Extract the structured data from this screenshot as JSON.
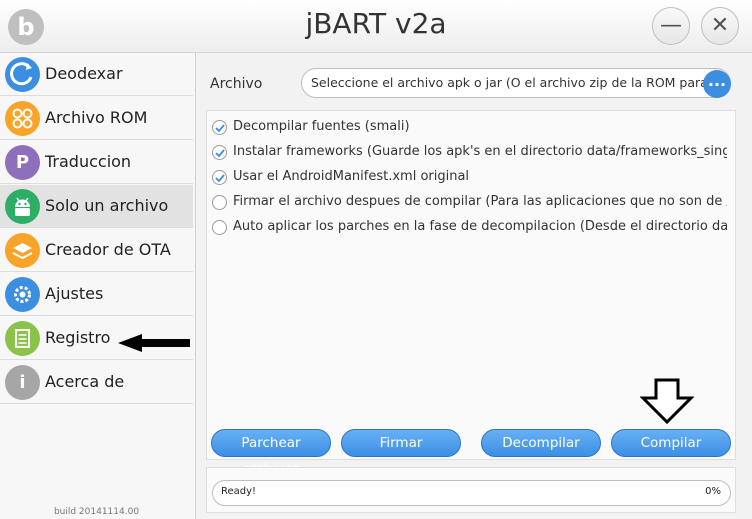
{
  "window": {
    "title": "jBART v2a",
    "logo_letter": "b",
    "minimize_icon": "—",
    "close_icon": "✕"
  },
  "sidebar": {
    "items": [
      {
        "label": "Deodexar",
        "icon": "deodex-icon",
        "color": "#3b8ee0"
      },
      {
        "label": "Archivo ROM",
        "icon": "rom-icon",
        "color": "#f7a428"
      },
      {
        "label": "Traduccion",
        "icon": "translate-icon",
        "letter": "P",
        "color": "#8e6fbb"
      },
      {
        "label": "Solo un archivo",
        "icon": "android-icon",
        "color": "#2cae66"
      },
      {
        "label": "Creador de OTA",
        "icon": "layers-icon",
        "color": "#f7a428"
      },
      {
        "label": "Ajustes",
        "icon": "gear-icon",
        "color": "#3b8ee0"
      },
      {
        "label": "Registro",
        "icon": "document-icon",
        "color": "#8bc34a"
      },
      {
        "label": "Acerca de",
        "icon": "info-icon",
        "letter": "i",
        "color": "#a6a6a6"
      }
    ],
    "active_index": 3,
    "build": "build 20141114.00"
  },
  "file": {
    "label": "Archivo",
    "placeholder": "Seleccione el archivo apk o jar (O el archivo zip de la ROM para",
    "browse_label": "..."
  },
  "options": [
    {
      "label": "Decompilar fuentes (smali)",
      "checked": true
    },
    {
      "label": "Instalar frameworks (Guarde los apk's en el directorio data/frameworks_single)",
      "checked": true
    },
    {
      "label": "Usar el AndroidManifest.xml original",
      "checked": true
    },
    {
      "label": "Firmar el archivo despues de compilar (Para las aplicaciones que no son de /system)",
      "checked": false
    },
    {
      "label": "Auto aplicar los parches en la fase de decompilacion (Desde el directorio data/patches)",
      "checked": false
    }
  ],
  "actions": {
    "patch": "Parchear archivos",
    "sign": "Firmar",
    "decompile": "Decompilar",
    "compile": "Compilar"
  },
  "status": {
    "text": "Ready!",
    "percent_label": "0%",
    "progress": 0
  },
  "colors": {
    "accent": "#3b8ee0",
    "active_row": "#e2e2e2"
  }
}
